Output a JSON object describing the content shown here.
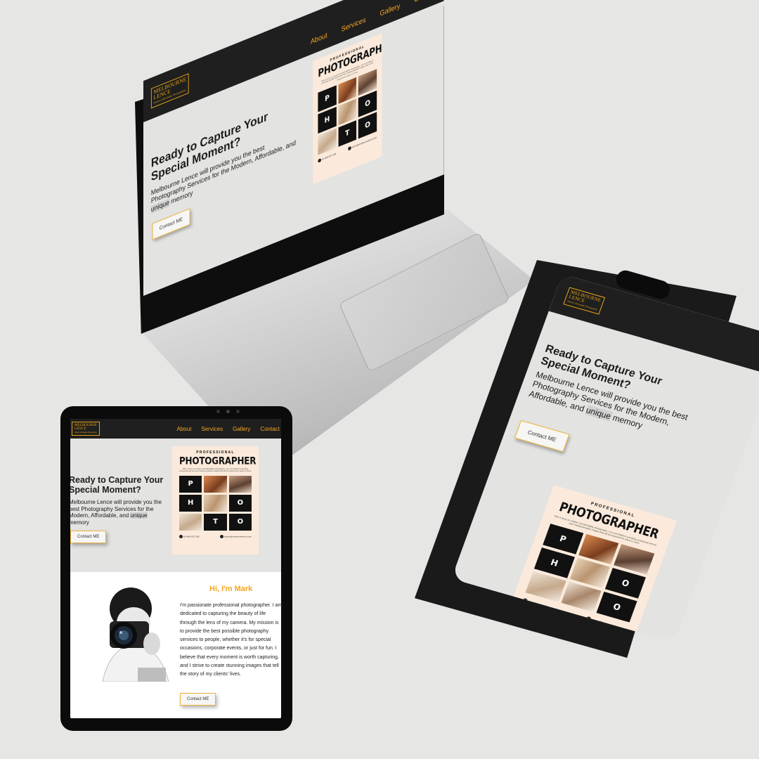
{
  "logo": {
    "line1": "MELBOURNE",
    "line2": "LENCE",
    "tagline": "Modern Affordable Photography"
  },
  "nav": {
    "about": "About",
    "services": "Services",
    "gallery": "Gallery",
    "contact": "Contact"
  },
  "hero": {
    "headline": "Ready to Capture Your Special Moment?",
    "tagline_pre": "Melbourne Lence will provide you the best Photography Services for the Modern, Affordable, and ",
    "tagline_hl": "unique",
    "tagline_post": " memory",
    "button": "Contact ME"
  },
  "poster": {
    "kicker": "PROFESSIONAL",
    "title": "PHOTOGRAPHER",
    "blurb": "With a focus on modern and affordable photography, I am committed to providing exceptional service and creating beautiful images that will be treasured for years to come.",
    "letters": [
      "P",
      "H",
      "O",
      "T",
      "O"
    ],
    "phone": "61 0400 027 568",
    "email": "admin@melbournelence.com"
  },
  "about": {
    "heading": "Hi, I'm Mark",
    "bio": "I'm passionate professional photographer. I am dedicated to capturing the beauty of life through the lens of my camera. My mission is to provide the best possible photography services to people, whether it's for special occasions, corporate events, or just for fun. I believe that every moment is worth capturing, and I strive to create stunning images that tell the story of my clients' lives.",
    "button": "Contact ME"
  },
  "hamburger": "≡",
  "colors": {
    "accent": "#f5a623",
    "nav_bg": "#1f1f1f",
    "hero_bg": "#e3e3e1",
    "poster_bg": "#fbeadb"
  }
}
